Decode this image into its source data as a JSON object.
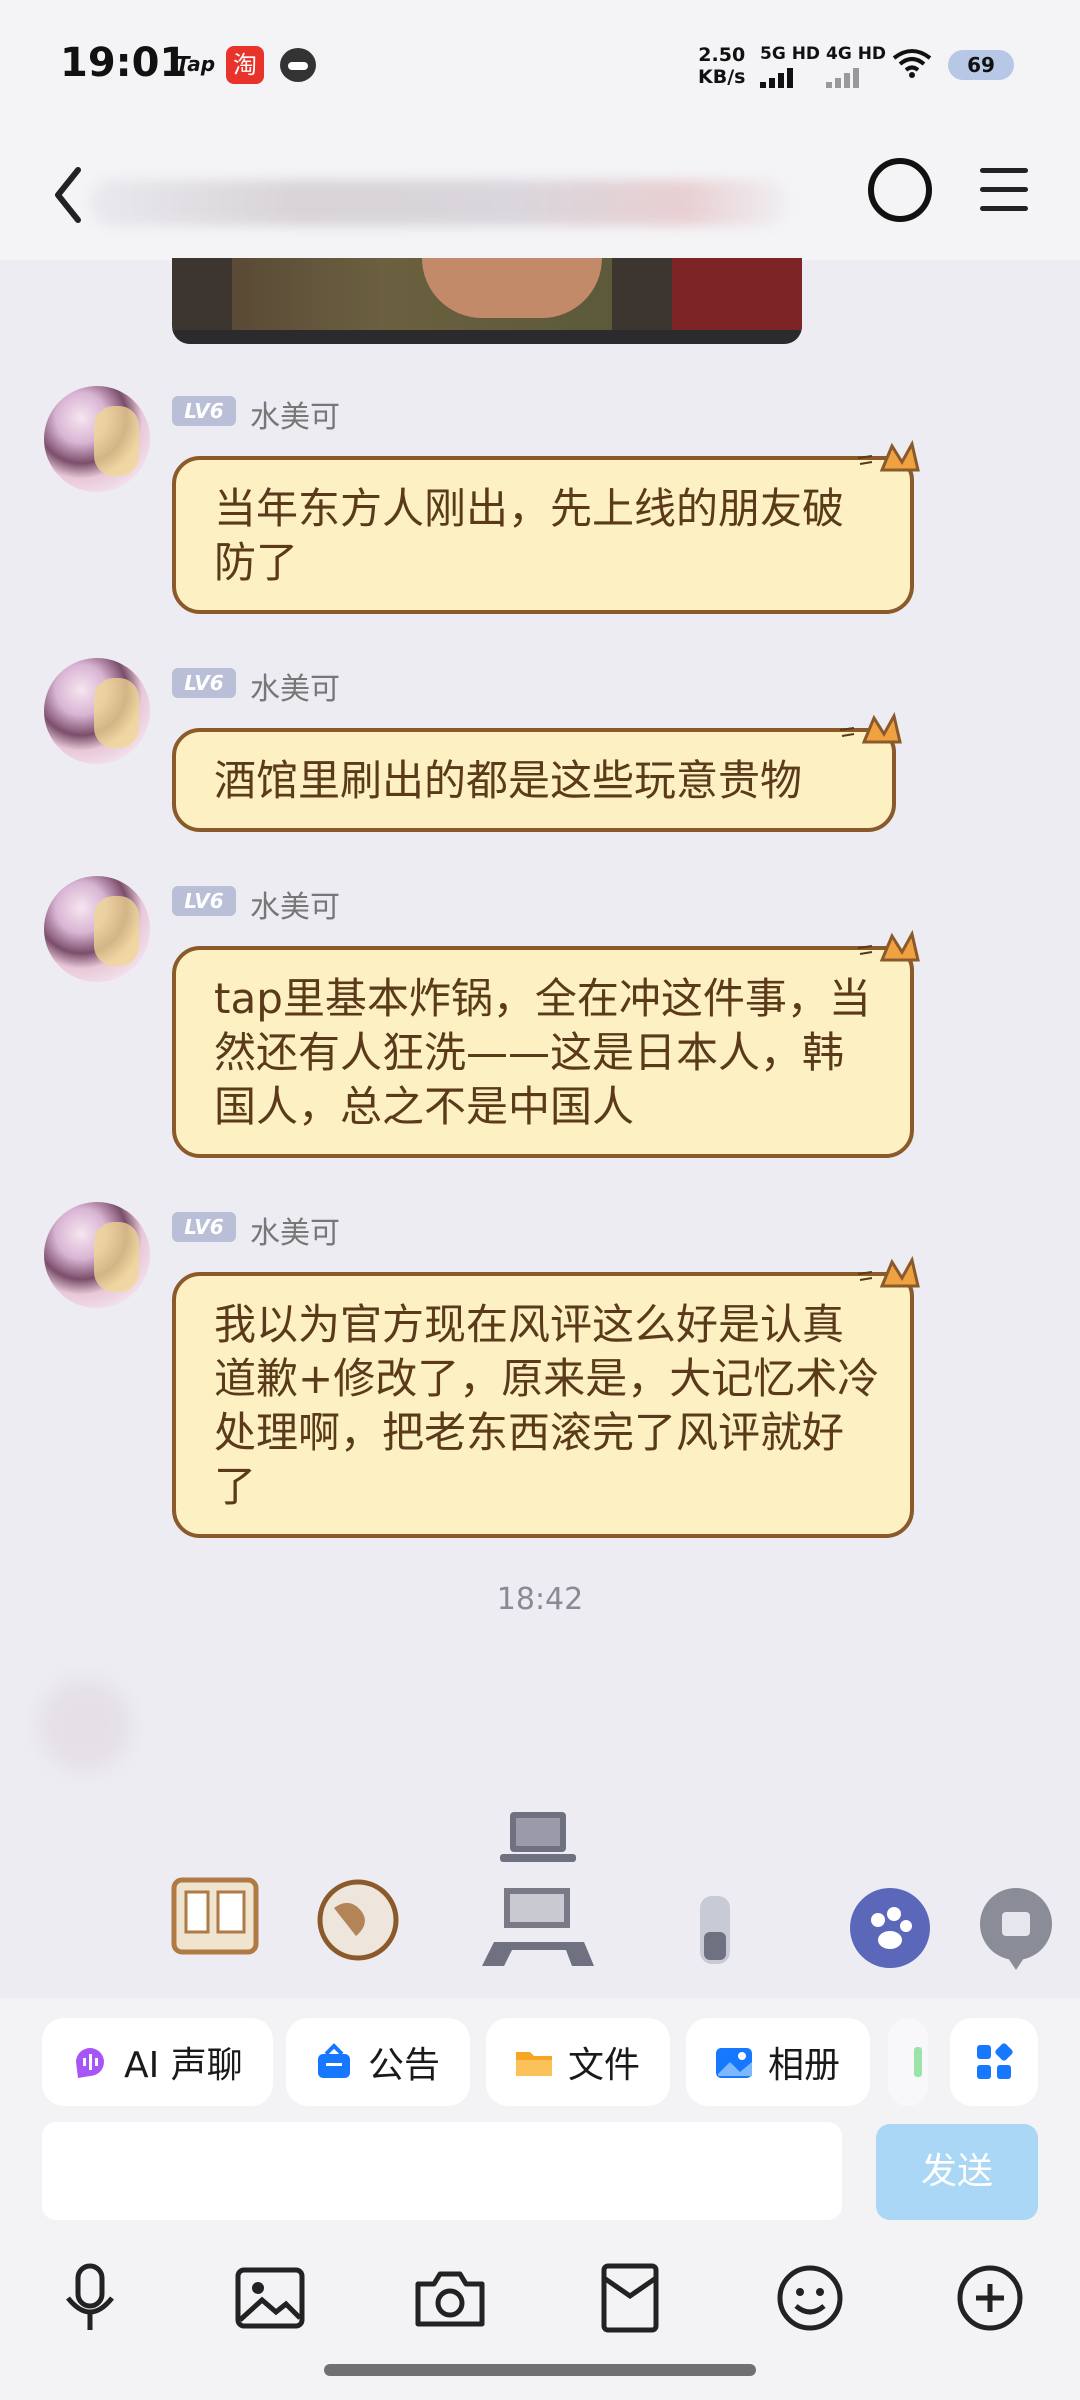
{
  "status_bar": {
    "time": "19:01",
    "tap_label": "Tap",
    "taobao_label": "淘",
    "net_speed_value": "2.50",
    "net_speed_unit": "KB/s",
    "sim1_label": "5G HD",
    "sim2_label": "4G HD",
    "battery": "69"
  },
  "chat": {
    "messages": [
      {
        "sender": "水美可",
        "level": "LV6",
        "text": "当年东方人刚出，先上线的朋友破防了"
      },
      {
        "sender": "水美可",
        "level": "LV6",
        "text": "酒馆里刷出的都是这些玩意贵物"
      },
      {
        "sender": "水美可",
        "level": "LV6",
        "text": "tap里基本炸锅，全在冲这件事，当然还有人狂洗——这是日本人，韩国人，总之不是中国人"
      },
      {
        "sender": "水美可",
        "level": "LV6",
        "text": "我以为官方现在风评这么好是认真道歉+修改了，原来是，大记忆术冷处理啊，把老东西滚完了风评就好了"
      }
    ],
    "timestamp": "18:42"
  },
  "quick_actions": [
    {
      "label": "AI 声聊",
      "icon": "ai-voice-icon",
      "color": "#a855f7"
    },
    {
      "label": "公告",
      "icon": "announcement-icon",
      "color": "#1677ff"
    },
    {
      "label": "文件",
      "icon": "folder-icon",
      "color": "#f5a623"
    },
    {
      "label": "相册",
      "icon": "album-icon",
      "color": "#1677ff"
    }
  ],
  "composer": {
    "input_value": "",
    "send_label": "发送"
  },
  "toolbar": {
    "items": [
      "microphone-icon",
      "image-icon",
      "camera-icon",
      "red-packet-icon",
      "emoji-icon",
      "plus-icon"
    ]
  },
  "colors": {
    "bubble_fill": "#fdf0c2",
    "bubble_border": "#8a5a2b",
    "send_button": "#a9d7f5",
    "level_badge": "#b9bfd6"
  }
}
